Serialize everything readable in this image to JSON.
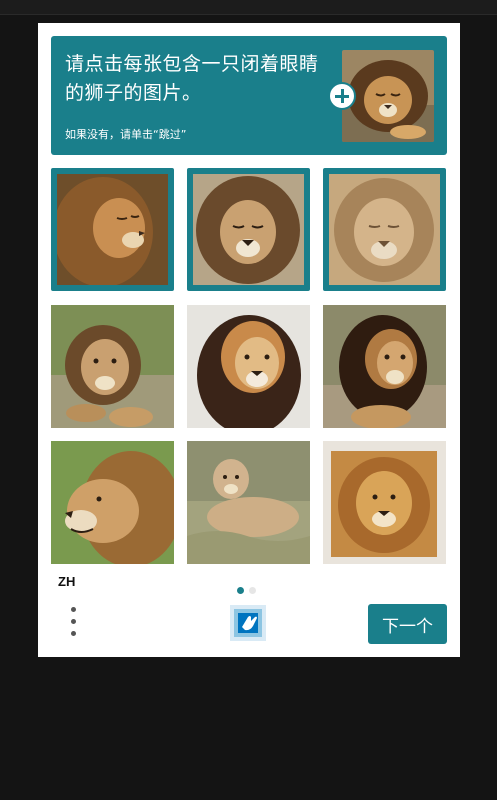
{
  "prompt": {
    "text": "请点击每张包含一只闭着眼睛的狮子的图片。",
    "subtext": "如果没有，请单击“跳过”",
    "example_image": "lion-resting-closed-eyes"
  },
  "tiles": [
    {
      "subject": "lion-maned-profile-closed-eyes",
      "selected": true
    },
    {
      "subject": "lion-maned-front-closed-eyes",
      "selected": true
    },
    {
      "subject": "lion-maned-front-blurred",
      "selected": true
    },
    {
      "subject": "lion-lying-on-grass",
      "selected": false
    },
    {
      "subject": "lion-dark-mane-front",
      "selected": false
    },
    {
      "subject": "lion-dark-mane-sitting",
      "selected": false
    },
    {
      "subject": "lion-profile-open-mouth",
      "selected": false
    },
    {
      "subject": "lioness-lying-in-grass",
      "selected": false
    },
    {
      "subject": "lion-maned-portrait-framed",
      "selected": false
    }
  ],
  "footer": {
    "language": "ZH",
    "next_label": "下一个",
    "page_indicator": {
      "current": 1,
      "total": 2
    }
  },
  "colors": {
    "accent": "#1a7f8b",
    "background": "#141414"
  },
  "icons": {
    "menu": "vertical-dots-icon",
    "logo": "hcaptcha-hand-icon",
    "add": "plus-icon"
  }
}
